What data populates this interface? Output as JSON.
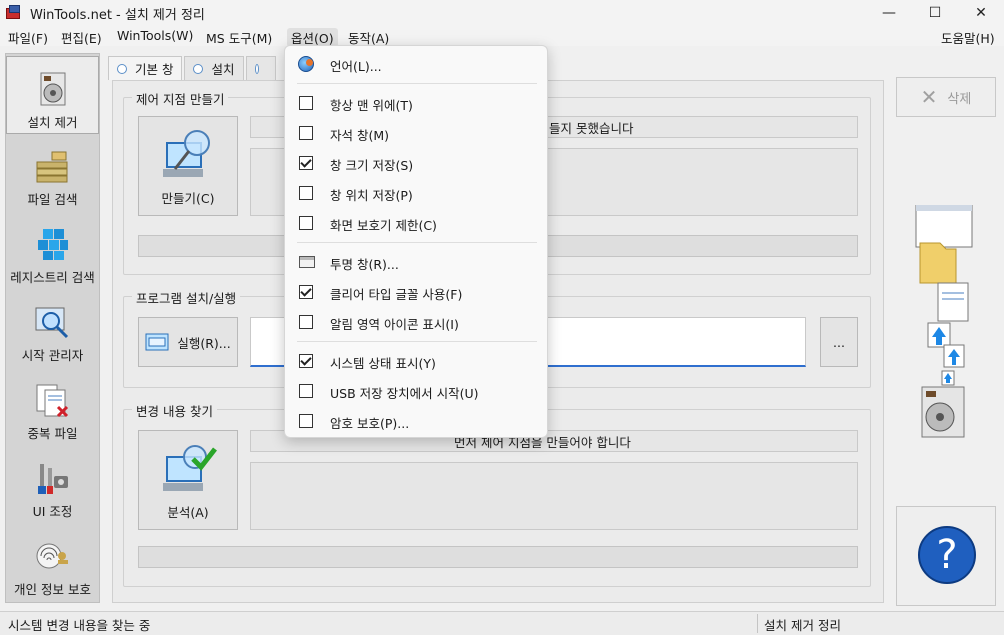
{
  "window": {
    "title": "WinTools.net - 설치 제거 정리",
    "controls": {
      "minimize": "—",
      "maximize": "☐",
      "close": "✕"
    }
  },
  "menubar": {
    "items": [
      "파일(F)",
      "편집(E)",
      "WinTools(W)",
      "MS 도구(M)",
      "옵션(O)",
      "동작(A)"
    ],
    "help": "도움말(H)",
    "active": "옵션(O)"
  },
  "nav": {
    "items": [
      {
        "label": "설치 제거",
        "icon": "uninstall-cd-icon"
      },
      {
        "label": "파일 검색",
        "icon": "file-search-icon"
      },
      {
        "label": "레지스트리 검색",
        "icon": "registry-cubes-icon"
      },
      {
        "label": "시작 관리자",
        "icon": "startup-manager-icon"
      },
      {
        "label": "중복 파일",
        "icon": "duplicate-files-icon"
      },
      {
        "label": "UI 조정",
        "icon": "ui-tweak-tools-icon"
      },
      {
        "label": "개인 정보 보호",
        "icon": "privacy-fingerprint-icon"
      }
    ],
    "selected": "설치 제거"
  },
  "tabs": [
    "기본 창",
    "설치",
    ""
  ],
  "groups": {
    "restore": {
      "title": "제어 지점 만들기",
      "button": "만들기(C)",
      "message": "들지 못했습니다"
    },
    "install": {
      "title": "프로그램 설치/실행",
      "button": "실행(R)...",
      "browse": "..."
    },
    "changes": {
      "title": "변경 내용 찾기",
      "button": "분석(A)",
      "message": "먼저 제어 지점을 만들어야 합니다"
    }
  },
  "right": {
    "delete_label": "삭제",
    "help_symbol": "?"
  },
  "status": {
    "left": "시스템 변경 내용을 찾는 중",
    "right": "설치 제거 정리"
  },
  "options_menu": {
    "items": [
      {
        "label": "언어(L)...",
        "type": "icon",
        "icon": "language-globe-icon"
      },
      {
        "type": "separator"
      },
      {
        "label": "항상 맨 위에(T)",
        "type": "check",
        "checked": false
      },
      {
        "label": "자석 창(M)",
        "type": "check",
        "checked": false
      },
      {
        "label": "창 크기 저장(S)",
        "type": "check",
        "checked": true
      },
      {
        "label": "창 위치 저장(P)",
        "type": "check",
        "checked": false
      },
      {
        "label": "화면 보호기 제한(C)",
        "type": "check",
        "checked": false
      },
      {
        "type": "separator"
      },
      {
        "label": "투명 창(R)...",
        "type": "icon",
        "icon": "transparent-window-icon"
      },
      {
        "label": "클리어 타입 글꼴 사용(F)",
        "type": "check",
        "checked": true
      },
      {
        "label": "알림 영역 아이콘 표시(I)",
        "type": "check",
        "checked": false
      },
      {
        "type": "separator"
      },
      {
        "label": "시스템 상태 표시(Y)",
        "type": "check",
        "checked": true
      },
      {
        "label": "USB 저장 장치에서 시작(U)",
        "type": "check",
        "checked": false
      },
      {
        "label": "암호 보호(P)...",
        "type": "check",
        "checked": false
      }
    ]
  }
}
